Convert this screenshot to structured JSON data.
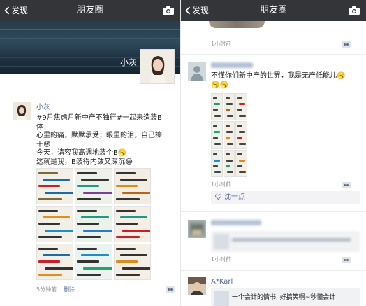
{
  "left": {
    "nav": {
      "back_label": "发现",
      "title": "朋友圈"
    },
    "cover": {
      "name": "小灰"
    },
    "post": {
      "author": "小灰",
      "lines": [
        "#9月焦虑月新中产不独行#一起来造装B",
        "体！",
        "心里的痛，默默承受；眼里的泪，自己擦",
        "干😓",
        "今天，请容我高调地装个B🥱",
        "这就是我，B装得内敛又深沉😂"
      ],
      "tiles": [
        {
          "bg": "#f2efe6",
          "lines": [
            "#7a6a3a",
            "#1e6aa8",
            "#c8202a",
            "#1e6aa8",
            "#7a6a3a"
          ]
        },
        {
          "bg": "#eef0ea",
          "lines": [
            "#333",
            "#333",
            "#1c9a8a",
            "#7a3f9a",
            "#333"
          ]
        },
        {
          "bg": "#f3ece0",
          "lines": [
            "#333",
            "#333",
            "#d98c1a",
            "#b8641a",
            "#333"
          ]
        },
        {
          "bg": "#f2efe6",
          "lines": [
            "#333",
            "#e88b1a",
            "#333",
            "#1c8fc4",
            "#333"
          ]
        },
        {
          "bg": "#eaf2ea",
          "lines": [
            "#333",
            "#1c9a8a",
            "#333",
            "#2d7ac4",
            "#333"
          ]
        },
        {
          "bg": "#f4eee4",
          "lines": [
            "#333",
            "#1c9a8a",
            "#333",
            "#c8202a",
            "#c8202a"
          ]
        },
        {
          "bg": "#f2efe6",
          "lines": [
            "#333",
            "#1e6aa8",
            "#c8202a",
            "#333",
            "#e88b1a"
          ]
        },
        {
          "bg": "#eaf3f0",
          "lines": [
            "#333",
            "#1c8fc4",
            "#333",
            "#25a36a",
            "#333"
          ]
        },
        {
          "bg": "#f4eee4",
          "lines": [
            "#333",
            "#333",
            "#d98c1a",
            "#333",
            "#333"
          ]
        }
      ],
      "time": "5分钟前",
      "delete_label": "删除"
    }
  },
  "right": {
    "nav": {
      "back_label": "发现",
      "title": "朋友圈"
    },
    "top_time": "1小时前",
    "post1": {
      "author": "",
      "lines": [
        "不懂你们新中产的世界，我是无产低能儿🥱",
        "🥱🥱"
      ],
      "tiles": [
        {
          "bg": "#f2efe6",
          "lines": [
            "#444",
            "#1c9a8a",
            "#444",
            "#444"
          ]
        },
        {
          "bg": "#f0ece6",
          "lines": [
            "#444",
            "#444",
            "#b8641a",
            "#444"
          ]
        },
        {
          "bg": "#f2efe6",
          "lines": [
            "#444",
            "#c8202a",
            "#444",
            "#444"
          ]
        },
        {
          "bg": "#eef3ee",
          "lines": [
            "#444",
            "#25a36a",
            "#444",
            "#444"
          ]
        },
        {
          "bg": "#f4eee4",
          "lines": [
            "#444",
            "#444",
            "#d98c1a",
            "#444"
          ]
        },
        {
          "bg": "#f2efe6",
          "lines": [
            "#444",
            "#444",
            "#c8202a",
            "#444"
          ]
        },
        {
          "bg": "#eef0ea",
          "lines": [
            "#444",
            "#1c8fc4",
            "#444",
            "#444"
          ]
        },
        {
          "bg": "#f2efe6",
          "lines": [
            "#444",
            "#444",
            "#25a36a",
            "#444"
          ]
        },
        {
          "bg": "#f4eee4",
          "lines": [
            "#444",
            "#d98c1a",
            "#444",
            "#444"
          ]
        }
      ],
      "time": "1小时前",
      "like": "沈一点"
    },
    "post2": {
      "time": "1小时前"
    },
    "post3": {
      "author": "A*Karl",
      "text": "一个会计的情书, 好搞笑啊~秒懂会计"
    }
  },
  "colors": {
    "nav_bg": "#333539",
    "link": "#576b95",
    "meta": "#999999"
  }
}
